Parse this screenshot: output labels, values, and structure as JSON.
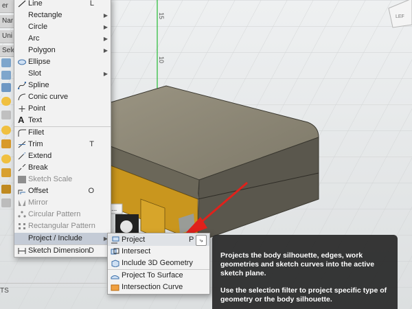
{
  "left_panel": {
    "labels": [
      "er",
      "Nar",
      "Uni",
      "Sele"
    ]
  },
  "axis_labels": [
    "15",
    "10",
    "05",
    "0"
  ],
  "viewcube_label": "LEF",
  "canvas_button": "...",
  "sketch_menu": {
    "items": [
      {
        "label": "Line",
        "shortcut": "L",
        "icon": "line-icon",
        "submenu": false
      },
      {
        "label": "Rectangle",
        "icon": "rectangle-icon",
        "submenu": true
      },
      {
        "label": "Circle",
        "icon": "circle-icon",
        "submenu": true
      },
      {
        "label": "Arc",
        "icon": "arc-icon",
        "submenu": true
      },
      {
        "label": "Polygon",
        "icon": "polygon-icon",
        "submenu": true
      },
      {
        "label": "Ellipse",
        "icon": "ellipse-icon",
        "submenu": false
      },
      {
        "label": "Slot",
        "icon": "slot-icon",
        "submenu": true
      },
      {
        "label": "Spline",
        "icon": "spline-icon",
        "submenu": false
      },
      {
        "label": "Conic curve",
        "icon": "conic-curve-icon",
        "submenu": false
      },
      {
        "label": "Point",
        "icon": "point-icon",
        "submenu": false
      },
      {
        "label": "Text",
        "icon": "text-icon",
        "submenu": false
      },
      {
        "label": "Fillet",
        "icon": "fillet-icon",
        "submenu": false
      },
      {
        "label": "Trim",
        "shortcut": "T",
        "icon": "trim-icon",
        "submenu": false
      },
      {
        "label": "Extend",
        "icon": "extend-icon",
        "submenu": false
      },
      {
        "label": "Break",
        "icon": "break-icon",
        "submenu": false
      },
      {
        "label": "Sketch Scale",
        "icon": "sketch-scale-icon",
        "submenu": false,
        "disabled": true
      },
      {
        "label": "Offset",
        "shortcut": "O",
        "icon": "offset-icon",
        "submenu": false
      },
      {
        "label": "Mirror",
        "icon": "mirror-icon",
        "submenu": false,
        "disabled": true
      },
      {
        "label": "Circular Pattern",
        "icon": "circular-pattern-icon",
        "submenu": false,
        "disabled": true
      },
      {
        "label": "Rectangular Pattern",
        "icon": "rectangular-pattern-icon",
        "submenu": false,
        "disabled": true
      },
      {
        "label": "Project / Include",
        "icon": "",
        "submenu": true,
        "active": true
      },
      {
        "label": "Sketch Dimension",
        "shortcut": "D",
        "icon": "sketch-dimension-icon",
        "submenu": false
      }
    ]
  },
  "submenu": {
    "items": [
      {
        "label": "Project",
        "shortcut": "P",
        "icon": "project-icon",
        "highlighted": true
      },
      {
        "label": "Intersect",
        "icon": "intersect-icon"
      },
      {
        "label": "Include 3D Geometry",
        "icon": "include-3d-geometry-icon"
      },
      {
        "label": "Project To Surface",
        "icon": "project-to-surface-icon"
      },
      {
        "label": "Intersection Curve",
        "icon": "intersection-curve-icon"
      }
    ],
    "pin_icon": "pin-icon"
  },
  "tooltip": {
    "paragraph1": "Projects the body silhouette, edges, work geometries and sketch curves into the active sketch plane.",
    "paragraph2": "Use the selection filter to project specific type of geometry or the body silhouette."
  },
  "status_label": "TS",
  "colors": {
    "body_top": "#8a8574",
    "body_front": "#6a6658",
    "body_side": "#57544a",
    "gold": "#c9961e",
    "menu_bg": "#f2f2f2",
    "active_item": "#c4cbd6",
    "tooltip_bg": "#2b2b2b",
    "arrow": "#e0211b",
    "axis_green": "#22bb33"
  }
}
